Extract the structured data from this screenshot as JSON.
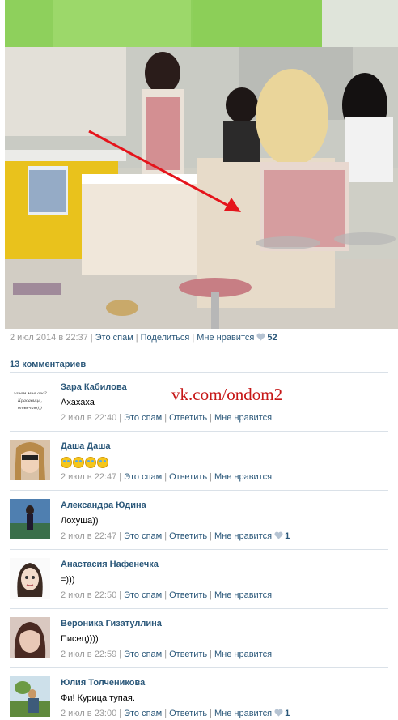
{
  "post": {
    "date": "2 июл 2014 в 22:37",
    "spam_label": "Это спам",
    "share_label": "Поделиться",
    "like_label": "Мне нравится",
    "like_count": "52"
  },
  "comments_header": "13 комментариев",
  "watermark": "vk.com/ondom2",
  "avatar_text": [
    "зачем мне ава?",
    "Красавица,",
    "отвечаю)))"
  ],
  "comments": [
    {
      "author": "Зара Кабилова",
      "text": "Ахахаха",
      "date": "2 июл в 22:40",
      "spam": "Это спам",
      "reply": "Ответить",
      "like": "Мне нравится",
      "likes": ""
    },
    {
      "author": "Даша Даша",
      "text": "",
      "date": "2 июл в 22:47",
      "spam": "Это спам",
      "reply": "Ответить",
      "like": "Мне нравится",
      "likes": ""
    },
    {
      "author": "Александра Юдина",
      "text": "Лохуша))",
      "date": "2 июл в 22:47",
      "spam": "Это спам",
      "reply": "Ответить",
      "like": "Мне нравится",
      "likes": "1"
    },
    {
      "author": "Анастасия Нафенечка",
      "text": "=)))",
      "date": "2 июл в 22:50",
      "spam": "Это спам",
      "reply": "Ответить",
      "like": "Мне нравится",
      "likes": ""
    },
    {
      "author": "Вероника Гизатуллина",
      "text": "Писец))))",
      "date": "2 июл в 22:59",
      "spam": "Это спам",
      "reply": "Ответить",
      "like": "Мне нравится",
      "likes": ""
    },
    {
      "author": "Юлия Толченикова",
      "text": "Фи! Курица тупая.",
      "date": "2 июл в 23:00",
      "spam": "Это спам",
      "reply": "Ответить",
      "like": "Мне нравится",
      "likes": "1"
    }
  ],
  "colors": {
    "link": "#2b587a",
    "meta": "#999999",
    "watermark": "#c61717",
    "divider": "#dae1e8"
  }
}
